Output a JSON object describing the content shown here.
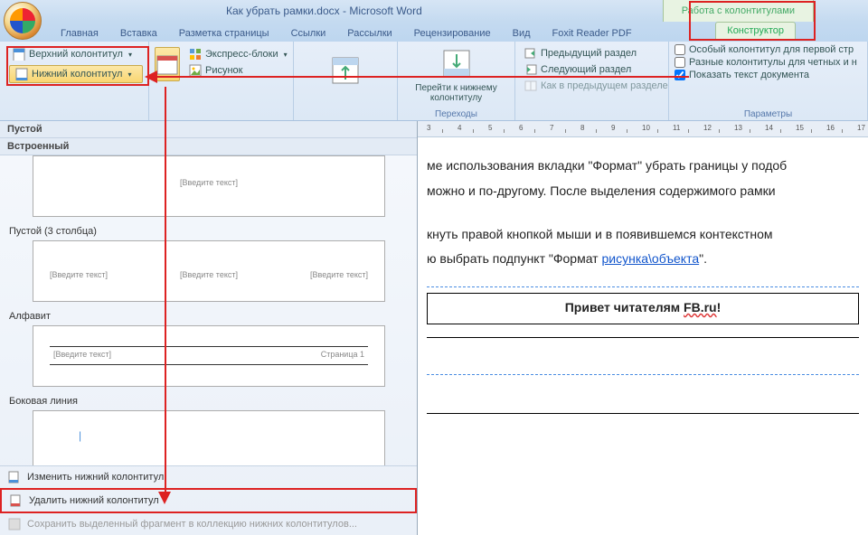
{
  "title": "Как убрать рамки.docx - Microsoft Word",
  "tool_tab": "Работа с колонтитулами",
  "tabs": [
    "Главная",
    "Вставка",
    "Разметка страницы",
    "Ссылки",
    "Рассылки",
    "Рецензирование",
    "Вид",
    "Foxit Reader PDF",
    "Конструктор"
  ],
  "active_tab_index": 8,
  "ribbon": {
    "hf_group": {
      "top_btn": "Верхний колонтитул",
      "bottom_btn": "Нижний колонтитул"
    },
    "insert_group": {
      "blocks": "Экспресс-блоки",
      "picture": "Рисунок"
    },
    "nav_group": {
      "goto_label_top": "Перейти к нижнему",
      "goto_label_bot": "колонтитулу",
      "prev": "Предыдущий раздел",
      "next": "Следующий раздел",
      "as_prev": "Как в предыдущем разделе",
      "group_label": "Переходы"
    },
    "opts_group": {
      "first_page": "Особый колонтитул для первой стр",
      "odd_even": "Разные колонтитулы для четных и н",
      "show_text": "Показать текст документа",
      "group_label": "Параметры"
    }
  },
  "gallery": {
    "header1": "Пустой",
    "header2": "Встроенный",
    "items": [
      {
        "label": "",
        "previews": [
          {
            "text": "[Введите текст]",
            "pos": "center"
          }
        ],
        "lines": false
      },
      {
        "label": "Пустой (3 столбца)",
        "previews": [
          {
            "text": "[Введите текст]",
            "pos": "left"
          },
          {
            "text": "[Введите текст]",
            "pos": "center"
          },
          {
            "text": "[Введите текст]",
            "pos": "right"
          }
        ],
        "lines": false
      },
      {
        "label": "Алфавит",
        "previews": [
          {
            "text": "[Введите текст]",
            "pos": "left-bottom"
          },
          {
            "text": "Страница 1",
            "pos": "right-bottom"
          }
        ],
        "lines": true
      },
      {
        "label": "Боковая линия",
        "previews": [
          {
            "text": "|",
            "pos": "left-small"
          }
        ],
        "lines": false
      }
    ],
    "footer_items": [
      {
        "label": "Изменить нижний колонтитул",
        "disabled": false,
        "highlighted": false
      },
      {
        "label": "Удалить нижний колонтитул",
        "disabled": false,
        "highlighted": true
      },
      {
        "label": "Сохранить выделенный фрагмент в коллекцию нижних колонтитулов...",
        "disabled": true,
        "highlighted": false
      }
    ]
  },
  "document": {
    "p1": "ме использования вкладки \"Формат\" убрать границы у подоб",
    "p2": "можно и по-другому. После выделения содержимого рамки",
    "p3": "кнуть правой кнопкой мыши и в появившемся контекстном",
    "p4_pre": "ю выбрать подпункт \"Формат ",
    "p4_link": "рисунка\\объекта",
    "p4_post": "\".",
    "footer_text_pre": "Привет читателям ",
    "footer_text_u": "FB.ru",
    "footer_text_post": "!"
  },
  "ruler_marks": [
    "3",
    "4",
    "5",
    "6",
    "7",
    "8",
    "9",
    "10",
    "11",
    "12",
    "13",
    "14",
    "15",
    "16",
    "17"
  ]
}
